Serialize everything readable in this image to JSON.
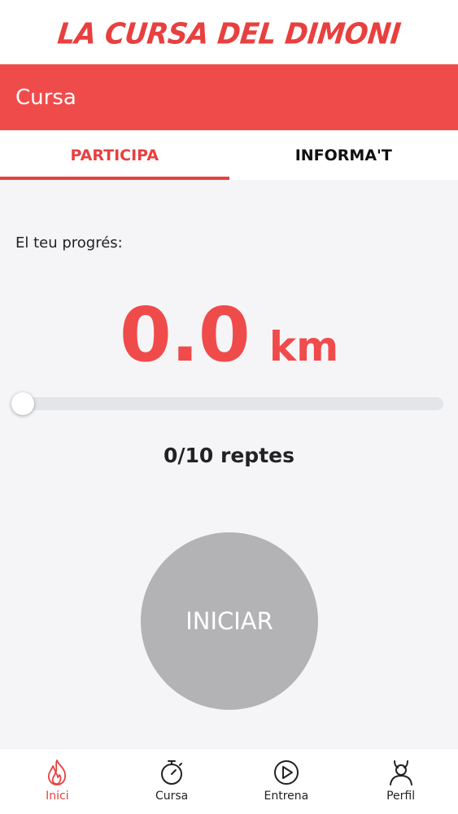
{
  "app": {
    "logo_text": "LA CURSA DEL DIMONI"
  },
  "header": {
    "title": "Cursa"
  },
  "tabs": [
    {
      "label": "PARTICIPA",
      "active": true
    },
    {
      "label": "INFORMA'T",
      "active": false
    }
  ],
  "progress": {
    "label": "El teu progrés:",
    "distance_value": "0.0",
    "distance_unit": "km",
    "slider_fraction": 0.0,
    "challenges_text": "0/10 reptes"
  },
  "start_button": {
    "label": "INICIAR"
  },
  "bottom_nav": [
    {
      "label": "Inici",
      "icon": "flame-icon",
      "active": true
    },
    {
      "label": "Cursa",
      "icon": "stopwatch-icon",
      "active": false
    },
    {
      "label": "Entrena",
      "icon": "play-circle-icon",
      "active": false
    },
    {
      "label": "Perfil",
      "icon": "devil-profile-icon",
      "active": false
    }
  ],
  "colors": {
    "accent": "#f04b4b",
    "accent_dark": "#e8403f",
    "button_disabled": "#b3b3b6",
    "background": "#f5f5f7"
  }
}
